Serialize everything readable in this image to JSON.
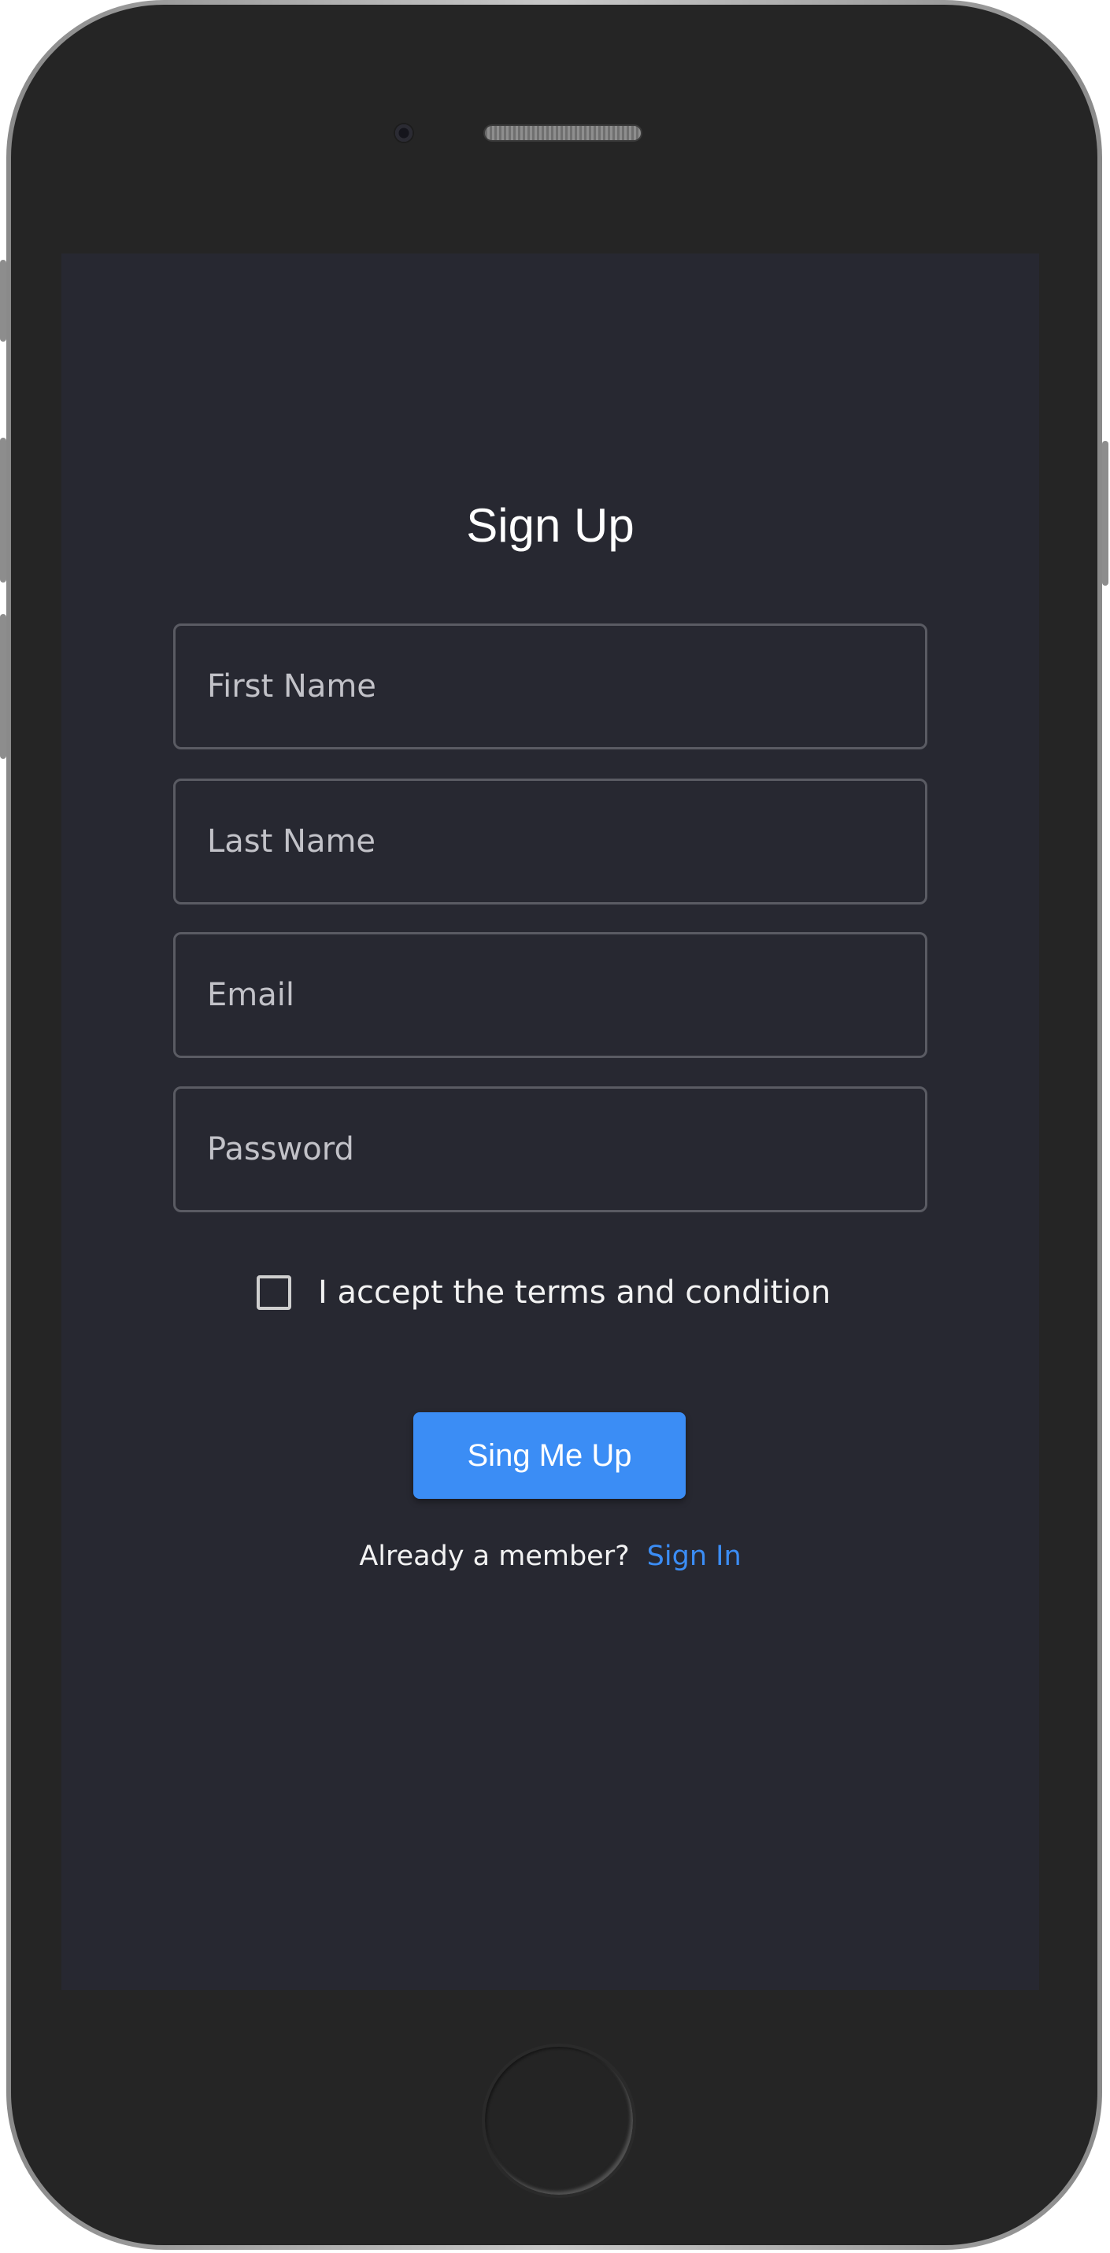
{
  "signup": {
    "title": "Sign Up",
    "fields": {
      "first_name_placeholder": "First Name",
      "last_name_placeholder": "Last Name",
      "email_placeholder": "Email",
      "password_placeholder": "Password"
    },
    "terms_label": "I accept the terms and condition",
    "terms_checked": false,
    "submit_label": "Sing Me Up",
    "member_prompt": "Already a member?",
    "signin_link": "Sign In"
  },
  "colors": {
    "screen_background": "#272831",
    "accent": "#3b8df5",
    "field_border": "#5a5b63",
    "device_body": "#252525"
  }
}
